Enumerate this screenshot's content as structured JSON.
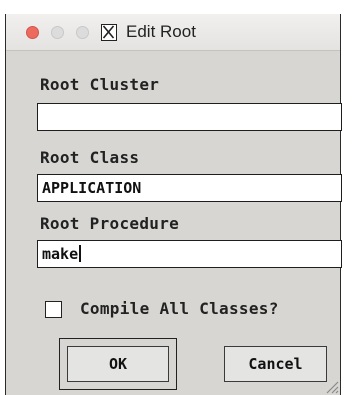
{
  "window": {
    "title": "Edit Root",
    "controls": [
      "close",
      "minimize",
      "zoom"
    ],
    "app_icon": "x11-icon"
  },
  "fields": [
    {
      "label": "Root Cluster",
      "value": ""
    },
    {
      "label": "Root Class",
      "value": "APPLICATION"
    },
    {
      "label": "Root Procedure",
      "value": "make",
      "focused": true
    }
  ],
  "checkbox": {
    "label": "Compile All Classes?",
    "checked": false
  },
  "buttons": {
    "ok": "OK",
    "cancel": "Cancel",
    "default": "ok"
  },
  "colors": {
    "window_bg": "#d7d6d3",
    "close_light": "#ed6a5e",
    "inactive_light": "#dcdcdc"
  }
}
